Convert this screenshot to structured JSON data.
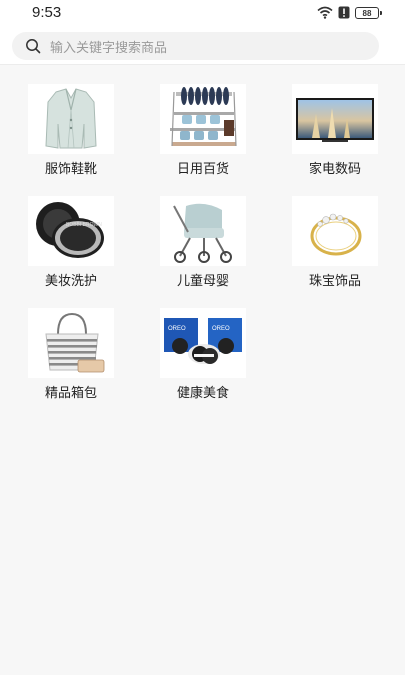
{
  "status_bar": {
    "time": "9:53",
    "battery": "88",
    "icons": [
      "wifi-icon",
      "alert-icon",
      "battery-icon"
    ]
  },
  "search": {
    "placeholder": "输入关键字搜索商品",
    "icon": "search-icon"
  },
  "categories": [
    {
      "label": "服饰鞋靴",
      "icon": "blazer-image"
    },
    {
      "label": "日用百货",
      "icon": "dish-rack-image"
    },
    {
      "label": "家电数码",
      "icon": "television-image"
    },
    {
      "label": "美妆洗护",
      "icon": "compact-powder-image"
    },
    {
      "label": "儿童母婴",
      "icon": "stroller-image"
    },
    {
      "label": "珠宝饰品",
      "icon": "ring-image"
    },
    {
      "label": "精品箱包",
      "icon": "tote-bag-image"
    },
    {
      "label": "健康美食",
      "icon": "cookies-image"
    }
  ],
  "colors": {
    "background": "#f7f7f7",
    "header": "#ffffff",
    "search_bg": "#f2f2f2"
  }
}
